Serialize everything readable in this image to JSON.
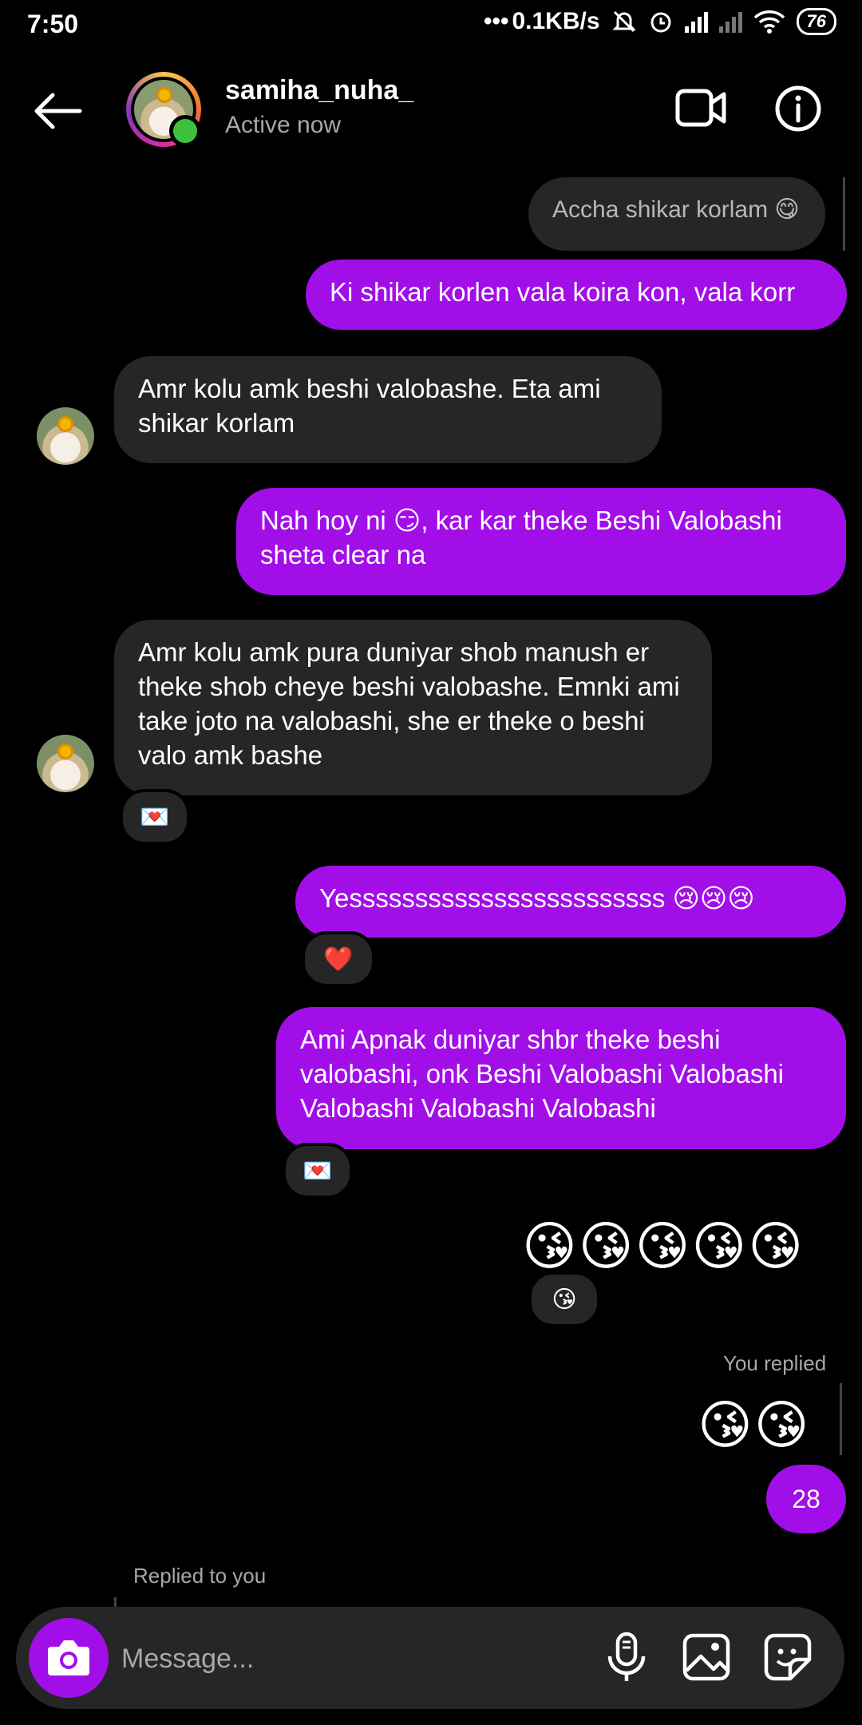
{
  "status_bar": {
    "time": "7:50",
    "network_speed": "0.1KB/s",
    "battery": "76"
  },
  "header": {
    "username": "samiha_nuha_",
    "activity": "Active now"
  },
  "messages": [
    {
      "side": "out",
      "text": "Accha shikar korlam 😋",
      "style": "faded"
    },
    {
      "side": "out",
      "text": "Ki shikar korlen vala koira kon, vala korr"
    },
    {
      "side": "in",
      "text": "Amr kolu amk beshi valobashe. Eta ami shikar korlam"
    },
    {
      "side": "out",
      "text": "Nah hoy ni 😏, kar kar theke Beshi Valobashi sheta clear na"
    },
    {
      "side": "in",
      "text": "Amr kolu amk pura duniyar shob manush er theke shob cheye beshi valobashe. Emnki ami take joto na valobashi, she er theke o beshi valo amk bashe",
      "reaction": "💌"
    },
    {
      "side": "out",
      "text": "Yessssssssssssssssssssssss 😢😢😢",
      "reaction": "❤️"
    },
    {
      "side": "out",
      "text": "Ami Apnak duniyar shbr theke beshi valobashi, onk Beshi Valobashi Valobashi Valobashi Valobashi Valobashi",
      "reaction": "💌"
    },
    {
      "side": "out",
      "text": "😘😘😘😘😘",
      "reaction": "😘"
    }
  ],
  "reply_block": {
    "label": "You replied",
    "quoted": "😘😘",
    "text": "28"
  },
  "incoming_reply_label": "Replied to you",
  "composer": {
    "placeholder": "Message..."
  },
  "icons": {
    "back": "back-arrow-icon",
    "video": "video-call-icon",
    "info": "info-icon",
    "camera": "camera-icon",
    "mic": "microphone-icon",
    "gallery": "gallery-icon",
    "sticker": "sticker-icon"
  },
  "colors": {
    "outgoing_bubble": "#a20ee8",
    "incoming_bubble": "#262626",
    "online_dot": "#3ec13e"
  }
}
